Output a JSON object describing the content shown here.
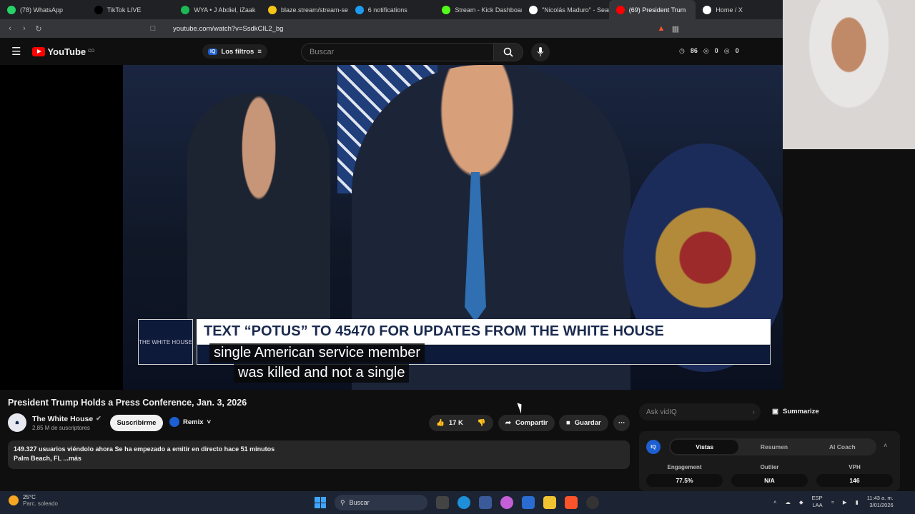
{
  "browser": {
    "tabs": [
      {
        "label": "(78) WhatsApp",
        "color": "#25d366"
      },
      {
        "label": "TikTok LIVE",
        "color": "#000000"
      },
      {
        "label": "WYA • J Abdiel, iZaak",
        "color": "#1db954"
      },
      {
        "label": "blaze.stream/stream-settin",
        "color": "#f5c518"
      },
      {
        "label": "6 notifications",
        "color": "#1d9bf0"
      },
      {
        "label": "Stream - Kick Dashboard",
        "color": "#53fc18"
      },
      {
        "label": "\"Nicolás Maduro\" - Searc",
        "color": "#ffffff"
      },
      {
        "label": "(69) President Trum",
        "color": "#ff0000"
      },
      {
        "label": "Home / X",
        "color": "#ffffff"
      }
    ],
    "url": "youtube.com/watch?v=SsdkCIL2_bg"
  },
  "youtube": {
    "logo_text": "YouTube",
    "logo_country": "CO",
    "filters_label": "Los filtros",
    "search_placeholder": "Buscar",
    "stats": {
      "a": "86",
      "b": "0",
      "c": "0"
    }
  },
  "video": {
    "banner_text": "TEXT “POTUS” TO 45470 FOR UPDATES FROM THE WHITE HOUSE",
    "caption_line1": "single American service member",
    "caption_line2": "was killed and not a single",
    "wh_logo_text": "THE WHITE HOUSE"
  },
  "meta": {
    "title": "President Trump Holds a Press Conference, Jan. 3, 2026",
    "channel_name": "The White House",
    "subscribers": "2,85 M de suscriptores",
    "subscribe_label": "Suscribirme",
    "remix_label": "Remix",
    "likes": "17 K",
    "share_label": "Compartir",
    "save_label": "Guardar",
    "desc_line1": "149.327 usuarios viéndolo ahora  Se ha empezado a emitir en directo hace 51 minutos",
    "desc_line2": "Palm Beach, FL  ...más"
  },
  "vidiq": {
    "ask_placeholder": "Ask vidIQ",
    "summarize_label": "Summarize",
    "iq_badge": "IQ",
    "tabs": [
      "Vistas",
      "Resumen",
      "AI Coach"
    ],
    "metrics": [
      {
        "label": "Engagement",
        "value": "77.5%"
      },
      {
        "label": "Outlier",
        "value": "N/A"
      },
      {
        "label": "VPH",
        "value": "146"
      }
    ]
  },
  "taskbar": {
    "temp": "25°C",
    "weather": "Parc. soleado",
    "search_label": "Buscar",
    "lang1": "ESP",
    "lang2": "LAA",
    "time": "11:43 a. m.",
    "date": "3/01/2026"
  }
}
